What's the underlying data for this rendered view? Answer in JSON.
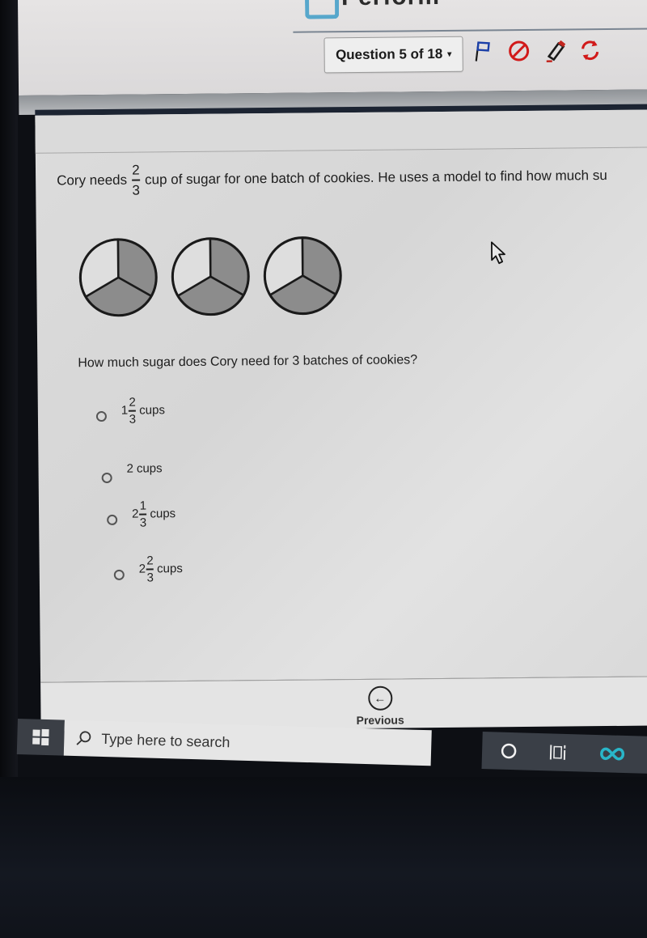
{
  "header": {
    "brand_partial": "Perform",
    "question_nav": {
      "label": "Question 5 of 18",
      "caret": "▾"
    },
    "tools": [
      {
        "name": "flag-icon",
        "color": "#1b3fa8"
      },
      {
        "name": "eliminate-icon",
        "color": "#d11a1a"
      },
      {
        "name": "highlighter-icon",
        "color": "#c2261f"
      },
      {
        "name": "refresh-icon",
        "color": "#d11a1a"
      }
    ]
  },
  "question": {
    "stem_before": "Cory needs",
    "stem_fraction": {
      "numerator": "2",
      "denominator": "3"
    },
    "stem_after": "cup of sugar for one batch of cookies.  He uses a model to find how much su",
    "models": [
      {
        "parts": 3,
        "shaded": 2
      },
      {
        "parts": 3,
        "shaded": 2
      },
      {
        "parts": 3,
        "shaded": 2
      }
    ],
    "prompt": "How much sugar does Cory need for 3 batches of cookies?",
    "choices": [
      {
        "whole": "1",
        "numerator": "2",
        "denominator": "3",
        "unit": "cups",
        "selected": false
      },
      {
        "whole": "2",
        "numerator": "",
        "denominator": "",
        "unit": "cups",
        "selected": false
      },
      {
        "whole": "2",
        "numerator": "1",
        "denominator": "3",
        "unit": "cups",
        "selected": false
      },
      {
        "whole": "2",
        "numerator": "2",
        "denominator": "3",
        "unit": "cups",
        "selected": false
      }
    ]
  },
  "footer": {
    "previous_label": "Previous",
    "previous_icon": "←"
  },
  "taskbar": {
    "search_placeholder": "Type here to search",
    "icons": [
      "windows-start-icon",
      "search-icon",
      "cortana-icon",
      "task-view-icon",
      "app-infinity-icon"
    ],
    "accent": "#29b6c9"
  },
  "colors": {
    "shaded": "#8c8c8c",
    "unshaded": "#dedede",
    "outline": "#1a1a1a"
  }
}
